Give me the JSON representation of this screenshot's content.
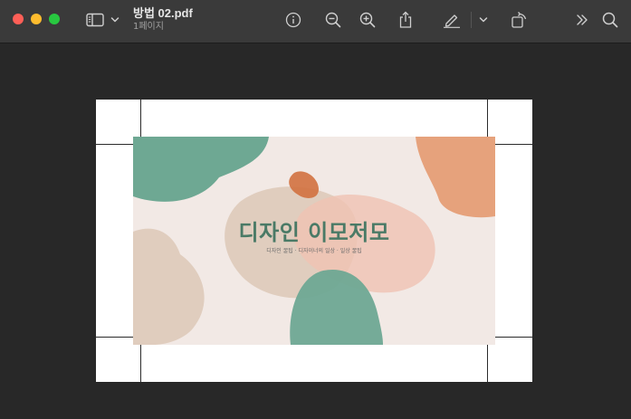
{
  "window": {
    "title": "방법 02.pdf",
    "subtitle": "1페이지"
  },
  "toolbar": {
    "icons": [
      "sidebar-icon",
      "chevron-down-icon",
      "info-icon",
      "zoom-out-icon",
      "zoom-in-icon",
      "share-icon",
      "markup-pen-icon",
      "chevron-down-icon",
      "rotate-icon",
      "more-chevrons-icon",
      "search-icon"
    ]
  },
  "slide": {
    "title": "디자인 이모저모",
    "subtitle": "디자인 꿀팁 · 디자이너의 일상 · 일상 꿀팁"
  },
  "colors": {
    "green": "#6ea893",
    "beige": "#e0cdbe",
    "orange": "#e6a27c",
    "dark_orange": "#d2713f",
    "pink": "#efc3b3",
    "slide_bg": "#f2e9e5"
  }
}
